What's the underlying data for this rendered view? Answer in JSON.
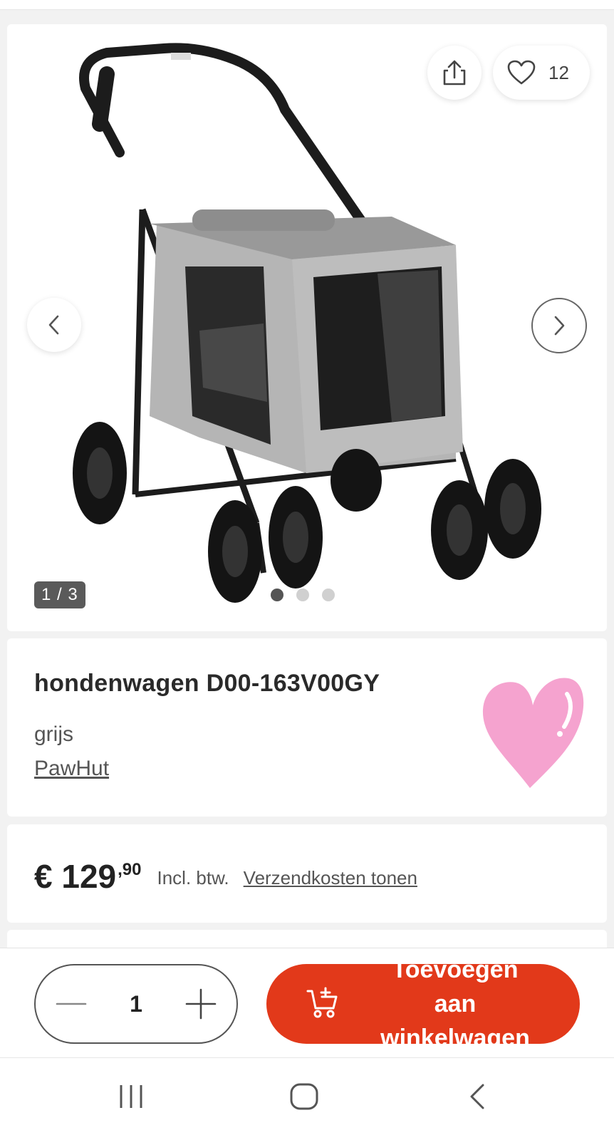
{
  "gallery": {
    "counter": "1 / 3",
    "like_count": "12",
    "dots_total": 3,
    "dots_active": 1
  },
  "product": {
    "title": "hondenwagen D00-163V00GY",
    "color": "grijs",
    "brand": "PawHut"
  },
  "price": {
    "main": "€ 129",
    "cents": ",90",
    "vat_label": "Incl. btw.",
    "shipping_link": "Verzendkosten tonen"
  },
  "action_bar": {
    "quantity": "1",
    "add_to_cart_label": "Toevoegen aan winkelwagen"
  },
  "colors": {
    "accent": "#e2391a",
    "heart_sticker": "#f5a3cf"
  },
  "icons": [
    "share-icon",
    "heart-outline-icon",
    "chevron-left-icon",
    "chevron-right-icon",
    "minus-icon",
    "plus-icon",
    "cart-add-icon",
    "recent-apps-icon",
    "home-icon",
    "back-icon"
  ]
}
